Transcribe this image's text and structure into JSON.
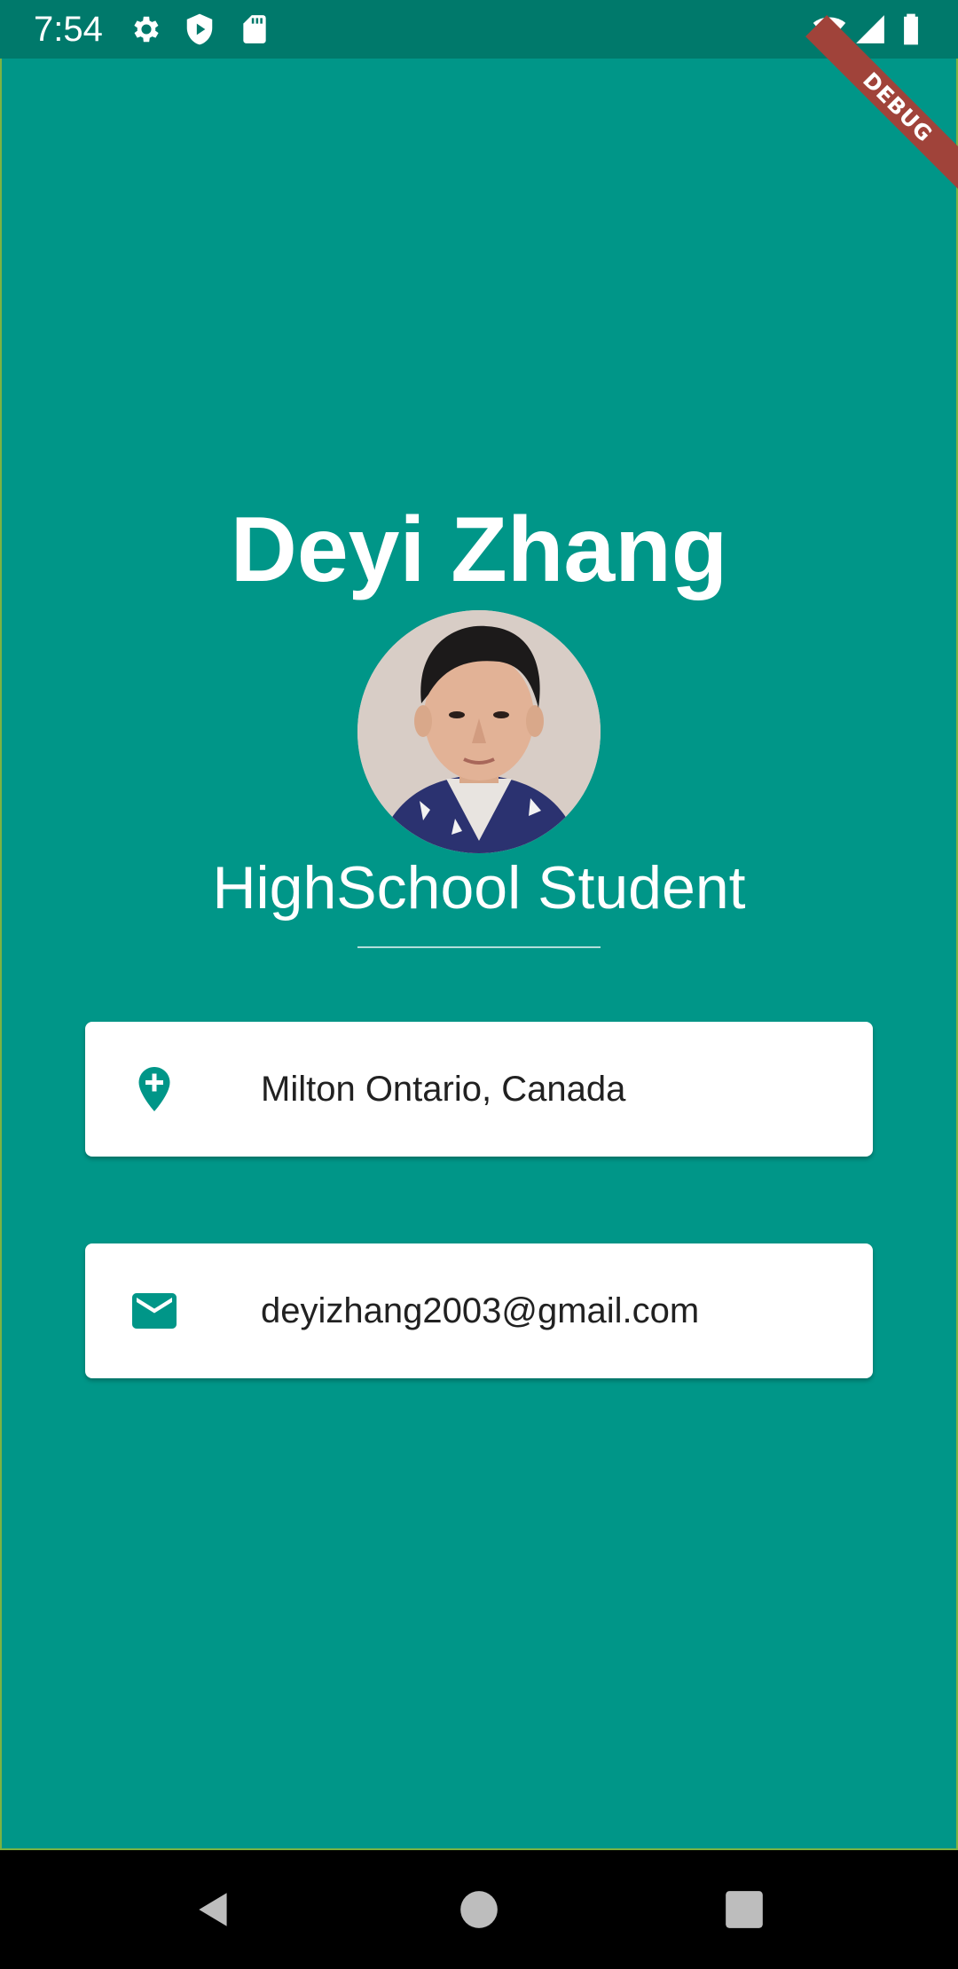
{
  "status_bar": {
    "time": "7:54",
    "icons": [
      "gear-icon",
      "play-protect-icon",
      "sd-card-icon",
      "wifi-icon",
      "signal-icon",
      "battery-icon"
    ]
  },
  "debug_banner": "DEBUG",
  "profile": {
    "name": "Deyi Zhang",
    "title": "HighSchool Student"
  },
  "contacts": [
    {
      "icon": "add-location-icon",
      "text": "Milton Ontario, Canada"
    },
    {
      "icon": "email-icon",
      "text": "deyizhang2003@gmail.com"
    }
  ],
  "colors": {
    "background": "#009688",
    "status_bar": "#00796B",
    "accent": "#009688",
    "card": "#ffffff"
  },
  "nav_bar": {
    "buttons": [
      "back-icon",
      "home-icon",
      "recents-icon"
    ]
  }
}
